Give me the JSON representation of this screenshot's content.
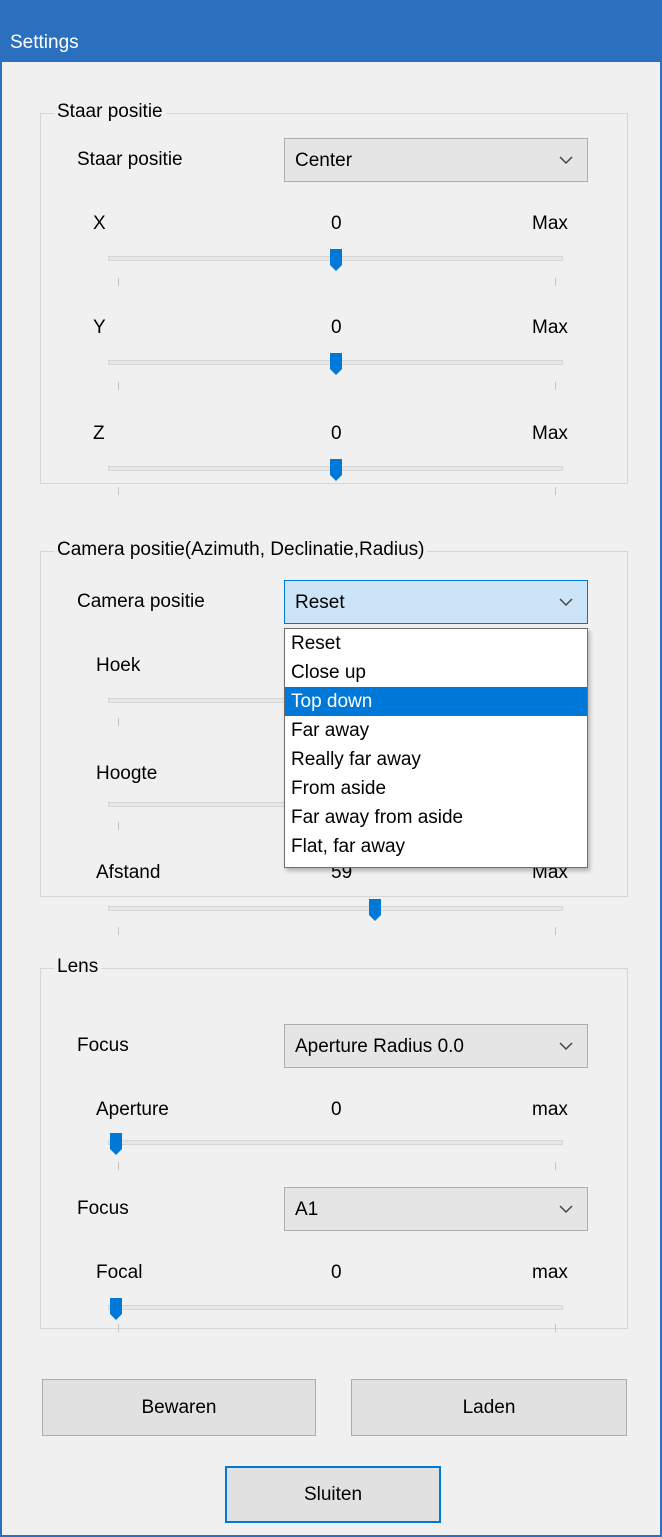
{
  "window": {
    "title": "Settings"
  },
  "staar": {
    "group_title": "Staar positie",
    "combo_label": "Staar positie",
    "combo_value": "Center",
    "sliders": [
      {
        "label": "X",
        "value": "0",
        "max_label": "Max",
        "position": 0.5
      },
      {
        "label": "Y",
        "value": "0",
        "max_label": "Max",
        "position": 0.5
      },
      {
        "label": "Z",
        "value": "0",
        "max_label": "Max",
        "position": 0.5
      }
    ]
  },
  "camera": {
    "group_title": "Camera positie(Azimuth, Declinatie,Radius)",
    "combo_label": "Camera positie",
    "combo_value": "Reset",
    "sliders": [
      {
        "label": "Hoek"
      },
      {
        "label": "Hoogte"
      },
      {
        "label": "Afstand",
        "value": "59",
        "max_label": "Max",
        "position": 0.59
      }
    ],
    "dropdown_options": [
      "Reset",
      "Close up",
      "Top down",
      "Far away",
      "Really far away",
      "From aside",
      "Far away from aside",
      "Flat, far away"
    ],
    "dropdown_selected": "Top down"
  },
  "lens": {
    "group_title": "Lens",
    "focus1_label": "Focus",
    "focus1_value": "Aperture Radius 0.0",
    "aperture": {
      "label": "Aperture",
      "value": "0",
      "max_label": "max",
      "position": 0.0
    },
    "focus2_label": "Focus",
    "focus2_value": "A1",
    "focal": {
      "label": "Focal",
      "value": "0",
      "max_label": "max",
      "position": 0.0
    }
  },
  "buttons": {
    "save": "Bewaren",
    "load": "Laden",
    "close": "Sluiten"
  },
  "colors": {
    "accent": "#0078d7",
    "titlebar": "#2b6fbf",
    "window_bg": "#f0f0f0"
  },
  "icons": {
    "combo_arrow": "chevron-down-icon",
    "slider_thumb": "slider-thumb-icon"
  }
}
